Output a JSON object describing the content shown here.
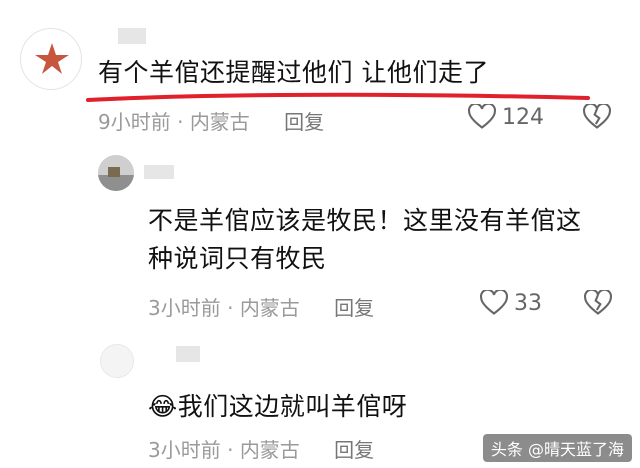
{
  "comments": [
    {
      "text_lines": [
        "有个羊倌还提醒过他们 让他们走了"
      ],
      "time": "9小时前",
      "location": "内蒙古",
      "reply_label": "回复",
      "likes": "124"
    },
    {
      "text_lines": [
        "不是羊倌应该是牧民！这里没有羊倌这",
        "种说词只有牧民"
      ],
      "time": "3小时前",
      "location": "内蒙古",
      "reply_label": "回复",
      "likes": "33"
    },
    {
      "text_lines": [
        "我们这边就叫羊倌呀"
      ],
      "emoji": "😂",
      "time": "3小时前",
      "location": "内蒙古",
      "reply_label": "回复"
    }
  ],
  "separator": " · ",
  "watermark": "头条 @晴天蓝了海",
  "colors": {
    "underline": "#e0202a",
    "meta": "#9a9a9a"
  },
  "icons": {
    "like": "heart-outline-icon",
    "dislike": "broken-heart-icon"
  }
}
